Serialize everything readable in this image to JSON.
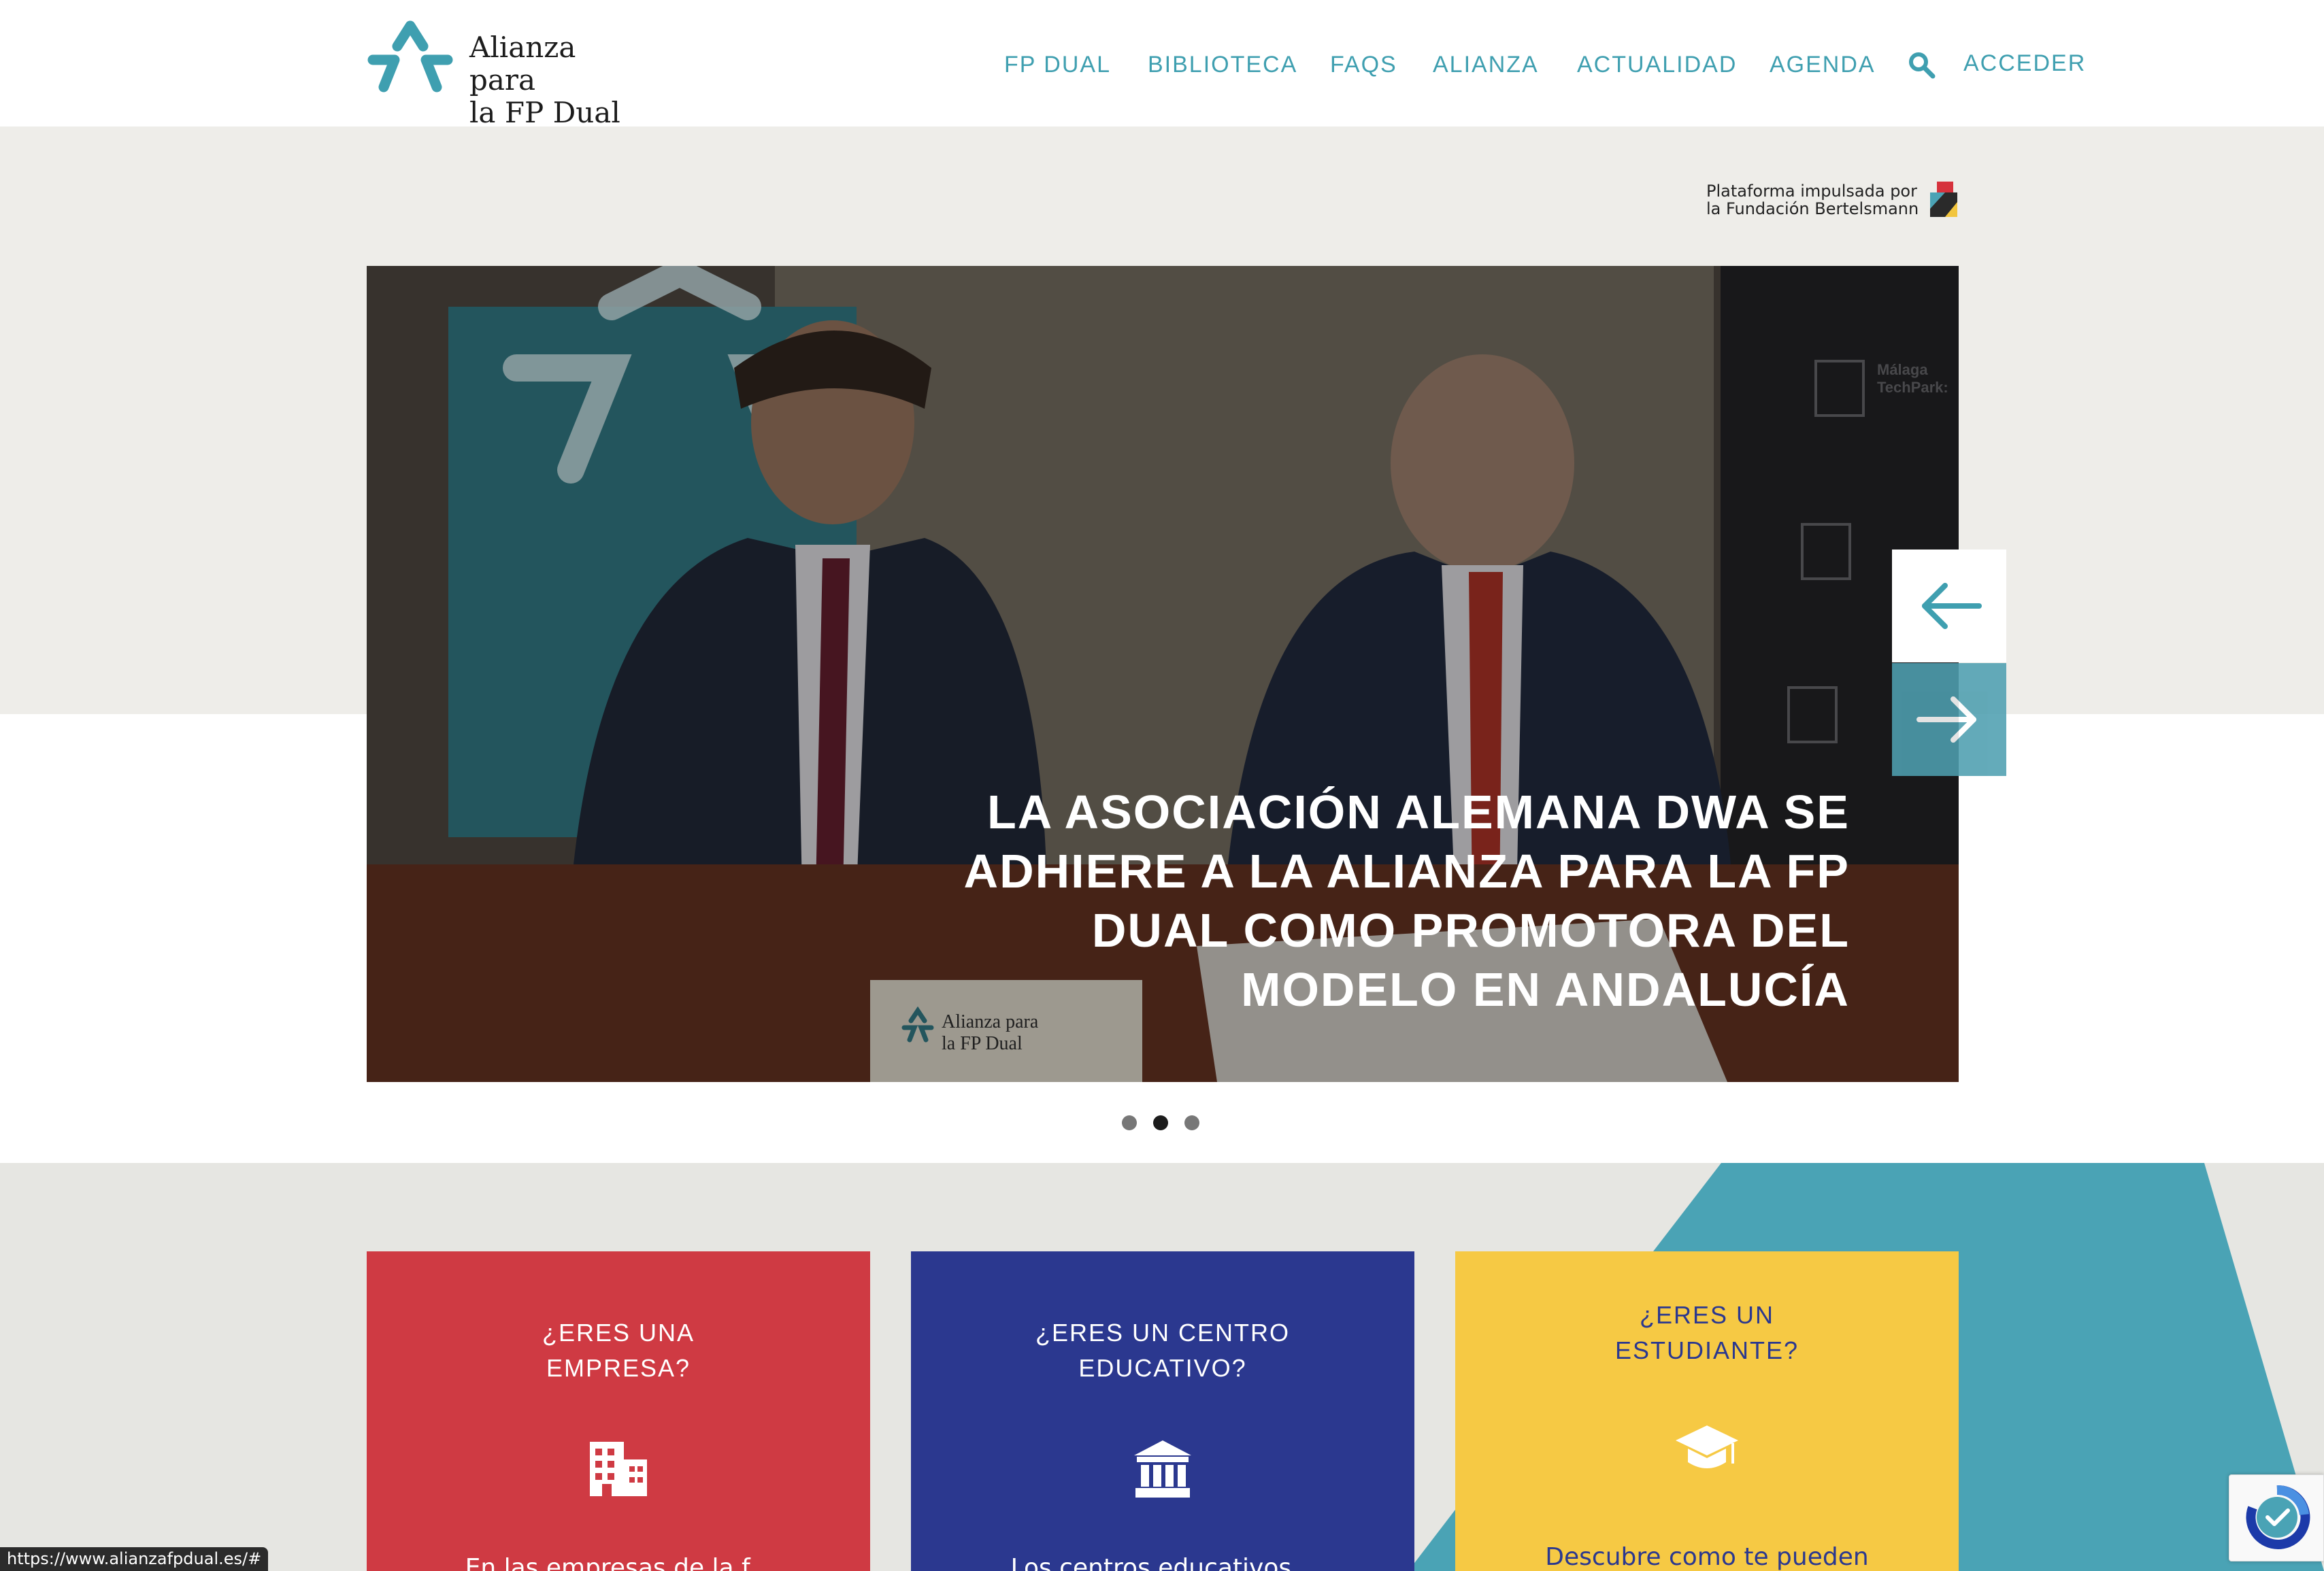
{
  "header": {
    "logo_line1": "Alianza para",
    "logo_line2": "la FP Dual",
    "nav": [
      {
        "label": "FP DUAL"
      },
      {
        "label": "BIBLIOTECA"
      },
      {
        "label": "FAQS"
      },
      {
        "label": "ALIANZA"
      },
      {
        "label": "ACTUALIDAD"
      },
      {
        "label": "AGENDA"
      }
    ],
    "search_icon": "search-icon",
    "acceder": "ACCEDER"
  },
  "platform": {
    "line1": "Plataforma impulsada por",
    "line2": "la Fundación Bertelsmann"
  },
  "slider": {
    "title": "LA ASOCIACIÓN ALEMANA DWA SE ADHIERE A LA ALIANZA PARA LA FP DUAL COMO PROMOTORA DEL MODELO EN ANDALUCÍA",
    "prev_icon": "arrow-left-icon",
    "next_icon": "arrow-right-icon",
    "dots_count": 3,
    "active_dot": 2,
    "photo_texts": {
      "techpark_line1": "Málaga",
      "techpark_line2": "TechPark:",
      "card_line1": "Alianza para",
      "card_line2": "la FP Dual"
    }
  },
  "cards": [
    {
      "title_line1": "¿ERES UNA",
      "title_line2": "EMPRESA?",
      "icon": "building-icon",
      "text": "En las empresas de la f...",
      "color": "#cf3a43"
    },
    {
      "title_line1": "¿ERES UN CENTRO",
      "title_line2": "EDUCATIVO?",
      "icon": "institution-icon",
      "text": "Los centros educativos...",
      "color": "#2b388f"
    },
    {
      "title_line1": "¿ERES UN",
      "title_line2": "ESTUDIANTE?",
      "icon": "graduation-cap-icon",
      "text": "Descubre como te pueden",
      "color": "#f6c944"
    }
  ],
  "status_url": "https://www.alianzafpdual.es/#",
  "colors": {
    "accent": "#3f9fb0",
    "hero_bg": "#eeede9",
    "cards_bg": "#e6e6e2",
    "teal_shape": "#4aa3b5"
  }
}
